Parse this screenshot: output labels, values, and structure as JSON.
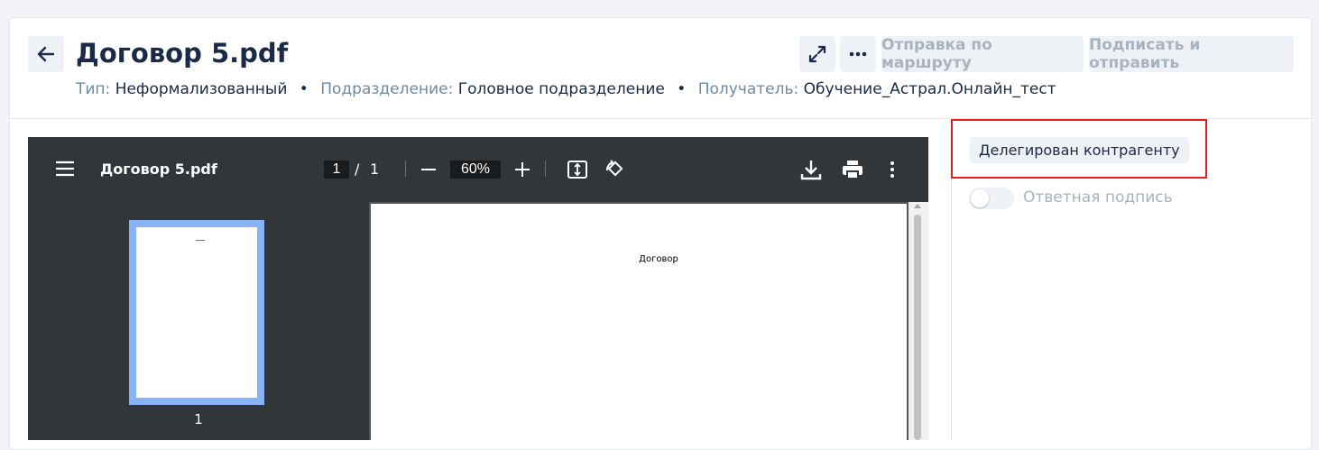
{
  "header": {
    "title": "Договор 5.pdf",
    "meta": {
      "type_label": "Тип:",
      "type_value": "Неформализованный",
      "dept_label": "Подразделение:",
      "dept_value": "Головное подразделение",
      "recipient_label": "Получатель:",
      "recipient_value": "Обучение_Астрал.Онлайн_тест",
      "separator": "•"
    },
    "actions": {
      "route_label": "Отправка по маршруту",
      "sign_send_label": "Подписать и отправить"
    }
  },
  "viewer": {
    "title": "Договор 5.pdf",
    "current_page": "1",
    "page_separator": "/",
    "total_pages": "1",
    "zoom": "60%",
    "thumbnail_number": "1",
    "page_content": "Договор"
  },
  "right_panel": {
    "status_badge": "Делегирован контрагенту",
    "toggle_label": "Ответная подпись",
    "toggle_on": false
  },
  "colors": {
    "highlight": "#e41e1e",
    "title": "#1b2a49",
    "muted_label": "#6f8aa8",
    "disabled_text": "#a9b3bf"
  },
  "icons": [
    "arrow-left-icon",
    "expand-icon",
    "more-horizontal-icon",
    "menu-icon",
    "zoom-out-icon",
    "zoom-in-icon",
    "fit-page-icon",
    "rotate-icon",
    "download-icon",
    "print-icon",
    "more-vertical-icon"
  ]
}
